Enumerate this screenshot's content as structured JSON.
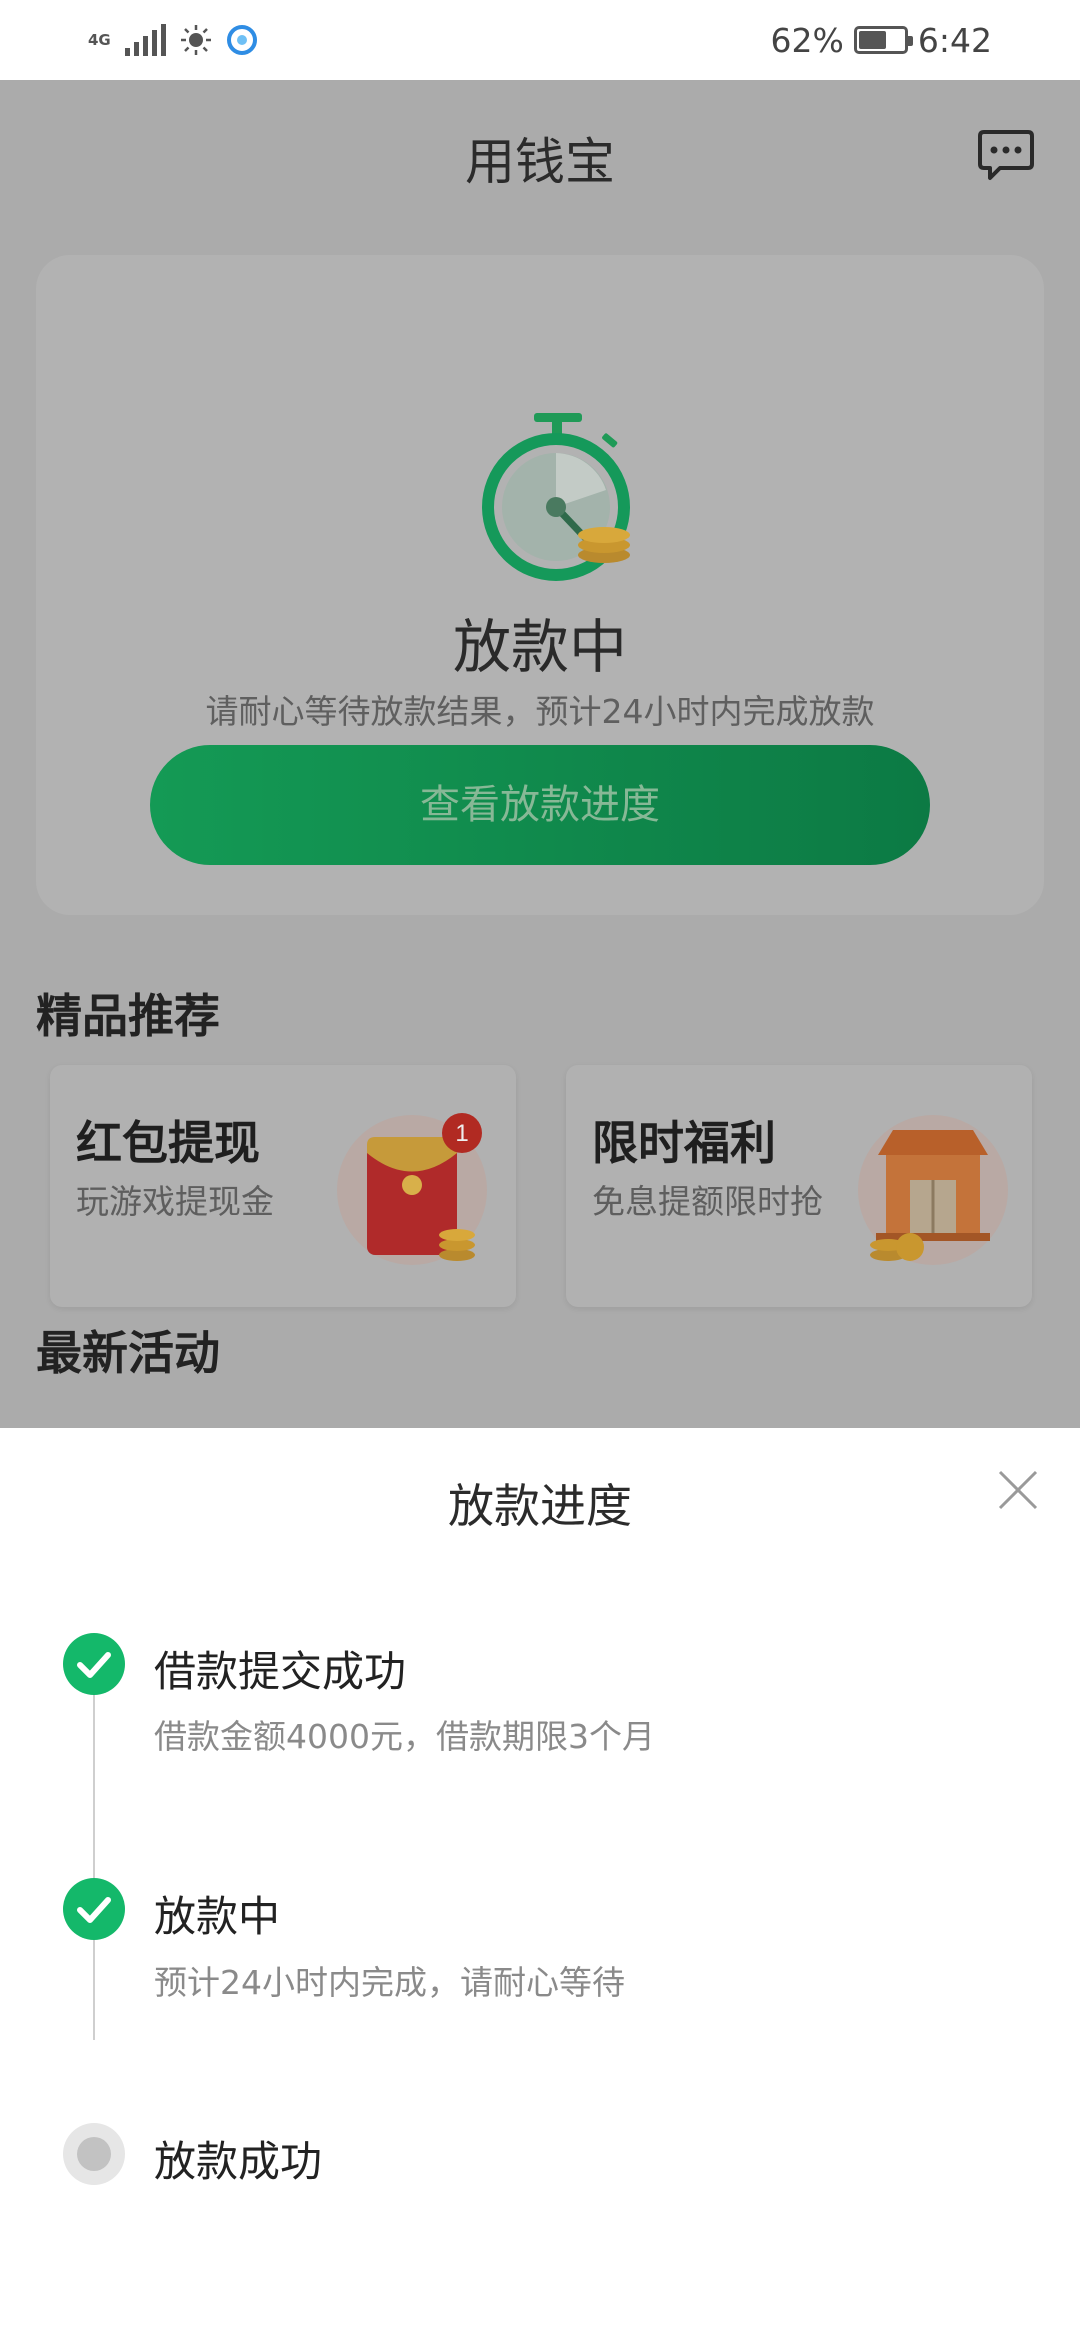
{
  "status_bar": {
    "network": "4G",
    "battery": "62%",
    "battery_level": 0.62,
    "time": "6:42",
    "icons": [
      "signal-icon",
      "brightness-icon",
      "browser-icon"
    ]
  },
  "header": {
    "title": "用钱宝",
    "chat_icon": "chat-bubble-icon"
  },
  "status_card": {
    "icon": "stopwatch-icon",
    "title": "放款中",
    "subtitle": "请耐心等待放款结果，预计24小时内完成放款",
    "button_label": "查看放款进度"
  },
  "recommend": {
    "section_title": "精品推荐",
    "cards": [
      {
        "title": "红包提现",
        "subtitle": "玩游戏提现金",
        "icon": "red-envelope-icon",
        "badge": "1"
      },
      {
        "title": "限时福利",
        "subtitle": "免息提额限时抢",
        "icon": "shop-icon"
      }
    ]
  },
  "activity": {
    "section_title": "最新活动"
  },
  "sheet": {
    "title": "放款进度",
    "close_icon": "close-icon",
    "steps": [
      {
        "title": "借款提交成功",
        "desc": "借款金额4000元，借款期限3个月",
        "state": "done"
      },
      {
        "title": "放款中",
        "desc": "预计24小时内完成，请耐心等待",
        "state": "done"
      },
      {
        "title": "放款成功",
        "desc": "",
        "state": "pending"
      }
    ]
  },
  "colors": {
    "accent_green": "#14b86a",
    "button_green": "#0c7a44",
    "overlay_gray": "#ababab"
  }
}
